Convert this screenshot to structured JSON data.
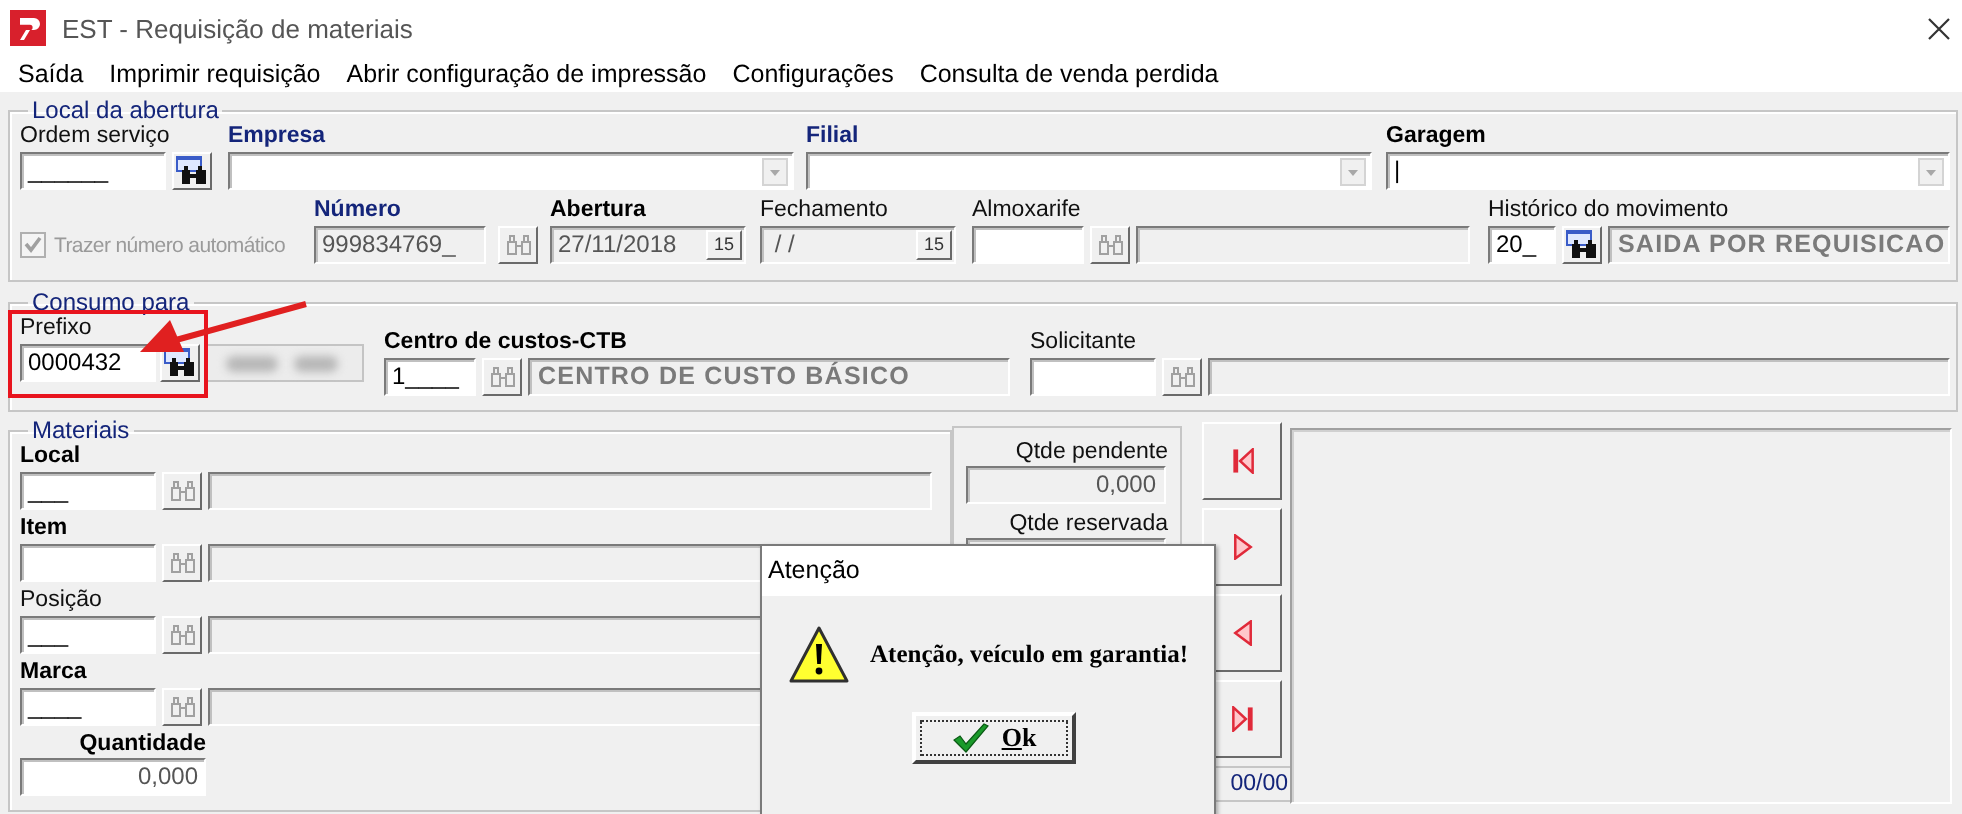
{
  "window": {
    "title": "EST - Requisição de materiais"
  },
  "menu": [
    "Saída",
    "Imprimir requisição",
    "Abrir configuração de impressão",
    "Configurações",
    "Consulta de venda perdida"
  ],
  "local_da_abertura": {
    "legend": "Local da abertura",
    "ordem_servico": {
      "label": {
        "text": "Ordem serviço",
        "kind": "plain"
      },
      "value": "______",
      "lookup_disabled": false
    },
    "empresa": {
      "label": {
        "text": "Empresa",
        "kind": "required"
      }
    },
    "filial": {
      "label": {
        "text": "Filial",
        "kind": "required"
      }
    },
    "garagem": {
      "label": {
        "text": "Garagem",
        "kind": "bold"
      },
      "value": "|"
    },
    "trazer_numero": {
      "label": "Trazer número automático",
      "checked": true,
      "disabled": true
    },
    "numero": {
      "label": {
        "text": "Número",
        "kind": "required"
      },
      "value": "999834769_",
      "disabled": true,
      "lookup_disabled": true
    },
    "abertura": {
      "label": {
        "text": "Abertura",
        "kind": "bold"
      },
      "value": "27/11/2018",
      "disabled": true,
      "calendar": "15"
    },
    "fechamento": {
      "label": {
        "text": "Fechamento",
        "kind": "plain"
      },
      "value": " / /",
      "disabled": true,
      "calendar": "15"
    },
    "almoxarife": {
      "label": {
        "text": "Almoxarife",
        "kind": "plain"
      },
      "disabled": false,
      "lookup_disabled": true
    },
    "historico": {
      "label": {
        "text": "Histórico do movimento",
        "kind": "plain"
      },
      "value": "20_",
      "disabled": false,
      "lookup_disabled": false,
      "description": "SAIDA POR REQUISICAO"
    }
  },
  "consumo_para": {
    "legend": "Consumo para",
    "prefixo": {
      "label": {
        "text": "Prefixo",
        "kind": "plain"
      },
      "value": "0000432",
      "lookup_disabled": false,
      "highlighted": true
    },
    "centro": {
      "label": {
        "text": "Centro de custos-CTB",
        "kind": "bold"
      },
      "value": "1____",
      "lookup_disabled": true,
      "description": "CENTRO DE CUSTO BÁSICO"
    },
    "solicitante": {
      "label": {
        "text": "Solicitante",
        "kind": "plain"
      },
      "lookup_disabled": true
    }
  },
  "materiais": {
    "legend": "Materiais",
    "fields": [
      {
        "label": {
          "text": "Local",
          "kind": "bold"
        },
        "value": "___",
        "lookup_disabled": true
      },
      {
        "label": {
          "text": "Item",
          "kind": "bold"
        },
        "lookup_disabled": true
      },
      {
        "label": {
          "text": "Posição",
          "kind": "plain"
        },
        "value": "___",
        "lookup_disabled": true
      },
      {
        "label": {
          "text": "Marca",
          "kind": "bold"
        },
        "value": "____",
        "lookup_disabled": true
      }
    ],
    "quantidade": {
      "label": {
        "text": "Quantidade",
        "kind": "bold"
      },
      "value": "0,000"
    },
    "qtde_pendente": {
      "label": {
        "text": "Qtde pendente",
        "kind": "plain"
      },
      "value": "0,000"
    },
    "qtde_reservada": {
      "label": {
        "text": "Qtde reservada",
        "kind": "plain"
      }
    }
  },
  "navigation": {
    "buttons": [
      {
        "kind": "first"
      },
      {
        "kind": "next"
      },
      {
        "kind": "previous"
      },
      {
        "kind": "last"
      }
    ],
    "counter": "00/00"
  },
  "dialog": {
    "title": "Atenção",
    "message": "Atenção, veículo em garantia!",
    "button": "Ok"
  }
}
